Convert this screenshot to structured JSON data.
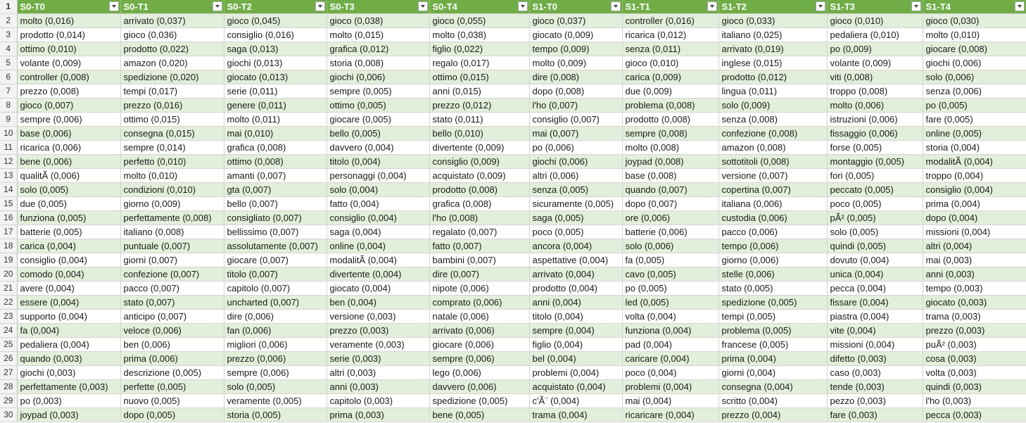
{
  "sheet": {
    "header_row_number": "1",
    "columns": [
      "S0-T0",
      "S0-T1",
      "S0-T2",
      "S0-T3",
      "S0-T4",
      "S1-T0",
      "S1-T1",
      "S1-T2",
      "S1-T3",
      "S1-T4"
    ],
    "rows": [
      {
        "n": "2",
        "cells": [
          "molto (0,016)",
          "arrivato (0,037)",
          "gioco (0,045)",
          "gioco (0,038)",
          "gioco (0,055)",
          "gioco (0,037)",
          "controller (0,016)",
          "gioco (0,033)",
          "gioco (0,010)",
          "gioco (0,030)"
        ]
      },
      {
        "n": "3",
        "cells": [
          "prodotto (0,014)",
          "gioco (0,036)",
          "consiglio (0,016)",
          "molto (0,015)",
          "molto (0,038)",
          "giocato (0,009)",
          "ricarica (0,012)",
          "italiano (0,025)",
          "pedaliera (0,010)",
          "molto (0,010)"
        ]
      },
      {
        "n": "4",
        "cells": [
          "ottimo (0,010)",
          "prodotto (0,022)",
          "saga (0,013)",
          "grafica (0,012)",
          "figlio (0,022)",
          "tempo (0,009)",
          "senza (0,011)",
          "arrivato (0,019)",
          "po (0,009)",
          "giocare (0,008)"
        ]
      },
      {
        "n": "5",
        "cells": [
          "volante (0,009)",
          "amazon (0,020)",
          "giochi (0,013)",
          "storia (0,008)",
          "regalo (0,017)",
          "molto (0,009)",
          "gioco (0,010)",
          "inglese (0,015)",
          "volante (0,009)",
          "giochi (0,006)"
        ]
      },
      {
        "n": "6",
        "cells": [
          "controller (0,008)",
          "spedizione (0,020)",
          "giocato (0,013)",
          "giochi (0,006)",
          "ottimo (0,015)",
          "dire (0,008)",
          "carica (0,009)",
          "prodotto (0,012)",
          "viti (0,008)",
          "solo (0,006)"
        ]
      },
      {
        "n": "7",
        "cells": [
          "prezzo (0,008)",
          "tempi (0,017)",
          "serie (0,011)",
          "sempre (0,005)",
          "anni (0,015)",
          "dopo (0,008)",
          "due (0,009)",
          "lingua (0,011)",
          "troppo (0,008)",
          "senza (0,006)"
        ]
      },
      {
        "n": "8",
        "cells": [
          "gioco (0,007)",
          "prezzo (0,016)",
          "genere (0,011)",
          "ottimo (0,005)",
          "prezzo (0,012)",
          "l'ho (0,007)",
          "problema (0,008)",
          "solo (0,009)",
          "molto (0,006)",
          "po (0,005)"
        ]
      },
      {
        "n": "9",
        "cells": [
          "sempre (0,006)",
          "ottimo (0,015)",
          "molto (0,011)",
          "giocare (0,005)",
          "stato (0,011)",
          "consiglio (0,007)",
          "prodotto (0,008)",
          "senza (0,008)",
          "istruzioni (0,006)",
          "fare (0,005)"
        ]
      },
      {
        "n": "10",
        "cells": [
          "base (0,006)",
          "consegna (0,015)",
          "mai (0,010)",
          "bello (0,005)",
          "bello (0,010)",
          "mai (0,007)",
          "sempre (0,008)",
          "confezione (0,008)",
          "fissaggio (0,006)",
          "online (0,005)"
        ]
      },
      {
        "n": "11",
        "cells": [
          "ricarica (0,006)",
          "sempre (0,014)",
          "grafica (0,008)",
          "davvero (0,004)",
          "divertente (0,009)",
          "po (0,006)",
          "molto (0,008)",
          "amazon (0,008)",
          "forse (0,005)",
          "storia (0,004)"
        ]
      },
      {
        "n": "12",
        "cells": [
          "bene (0,006)",
          "perfetto (0,010)",
          "ottimo (0,008)",
          "titolo (0,004)",
          "consiglio (0,009)",
          "giochi (0,006)",
          "joypad (0,008)",
          "sottotitoli (0,008)",
          "montaggio (0,005)",
          "modalitÃ  (0,004)"
        ]
      },
      {
        "n": "13",
        "cells": [
          "qualitÃ  (0,006)",
          "molto (0,010)",
          "amanti (0,007)",
          "personaggi (0,004)",
          "acquistato (0,009)",
          "altri (0,006)",
          "base (0,008)",
          "versione (0,007)",
          "fori (0,005)",
          "troppo (0,004)"
        ]
      },
      {
        "n": "14",
        "cells": [
          "solo (0,005)",
          "condizioni (0,010)",
          "gta (0,007)",
          "solo (0,004)",
          "prodotto (0,008)",
          "senza (0,005)",
          "quando (0,007)",
          "copertina (0,007)",
          "peccato (0,005)",
          "consiglio (0,004)"
        ]
      },
      {
        "n": "15",
        "cells": [
          "due (0,005)",
          "giorno (0,009)",
          "bello (0,007)",
          "fatto (0,004)",
          "grafica (0,008)",
          "sicuramente (0,005)",
          "dopo (0,007)",
          "italiana (0,006)",
          "poco (0,005)",
          "prima (0,004)"
        ]
      },
      {
        "n": "16",
        "cells": [
          "funziona (0,005)",
          "perfettamente (0,008)",
          "consigliato (0,007)",
          "consiglio (0,004)",
          "l'ho (0,008)",
          "saga (0,005)",
          "ore (0,006)",
          "custodia (0,006)",
          "pÃ² (0,005)",
          "dopo (0,004)"
        ]
      },
      {
        "n": "17",
        "cells": [
          "batterie (0,005)",
          "italiano (0,008)",
          "bellissimo (0,007)",
          "saga (0,004)",
          "regalato (0,007)",
          "poco (0,005)",
          "batterie (0,006)",
          "pacco (0,006)",
          "solo (0,005)",
          "missioni (0,004)"
        ]
      },
      {
        "n": "18",
        "cells": [
          "carica (0,004)",
          "puntuale (0,007)",
          "assolutamente (0,007)",
          "online (0,004)",
          "fatto (0,007)",
          "ancora (0,004)",
          "solo (0,006)",
          "tempo (0,006)",
          "quindi (0,005)",
          "altri (0,004)"
        ]
      },
      {
        "n": "19",
        "cells": [
          "consiglio (0,004)",
          "giorni (0,007)",
          "giocare (0,007)",
          "modalitÃ  (0,004)",
          "bambini (0,007)",
          "aspettative (0,004)",
          "fa (0,005)",
          "giorno (0,006)",
          "dovuto (0,004)",
          "mai (0,003)"
        ]
      },
      {
        "n": "20",
        "cells": [
          "comodo (0,004)",
          "confezione (0,007)",
          "titolo (0,007)",
          "divertente (0,004)",
          "dire (0,007)",
          "arrivato (0,004)",
          "cavo (0,005)",
          "stelle (0,006)",
          "unica (0,004)",
          "anni (0,003)"
        ]
      },
      {
        "n": "21",
        "cells": [
          "avere (0,004)",
          "pacco (0,007)",
          "capitolo (0,007)",
          "giocato (0,004)",
          "nipote (0,006)",
          "prodotto (0,004)",
          "po (0,005)",
          "stato (0,005)",
          "pecca (0,004)",
          "tempo (0,003)"
        ]
      },
      {
        "n": "22",
        "cells": [
          "essere (0,004)",
          "stato (0,007)",
          "uncharted (0,007)",
          "ben (0,004)",
          "comprato (0,006)",
          "anni (0,004)",
          "led (0,005)",
          "spedizione (0,005)",
          "fissare (0,004)",
          "giocato (0,003)"
        ]
      },
      {
        "n": "23",
        "cells": [
          "supporto (0,004)",
          "anticipo (0,007)",
          "dire (0,006)",
          "versione (0,003)",
          "natale (0,006)",
          "titolo (0,004)",
          "volta (0,004)",
          "tempi (0,005)",
          "piastra (0,004)",
          "trama (0,003)"
        ]
      },
      {
        "n": "24",
        "cells": [
          "fa (0,004)",
          "veloce (0,006)",
          "fan (0,006)",
          "prezzo (0,003)",
          "arrivato (0,006)",
          "sempre (0,004)",
          "funziona (0,004)",
          "problema (0,005)",
          "vite (0,004)",
          "prezzo (0,003)"
        ]
      },
      {
        "n": "25",
        "cells": [
          "pedaliera (0,004)",
          "ben (0,006)",
          "migliori (0,006)",
          "veramente (0,003)",
          "giocare (0,006)",
          "figlio (0,004)",
          "pad (0,004)",
          "francese (0,005)",
          "missioni (0,004)",
          "puÃ² (0,003)"
        ]
      },
      {
        "n": "26",
        "cells": [
          "quando (0,003)",
          "prima (0,006)",
          "prezzo (0,006)",
          "serie (0,003)",
          "sempre (0,006)",
          "bel (0,004)",
          "caricare (0,004)",
          "prima (0,004)",
          "difetto (0,003)",
          "cosa (0,003)"
        ]
      },
      {
        "n": "27",
        "cells": [
          "giochi (0,003)",
          "descrizione (0,005)",
          "sempre (0,006)",
          "altri (0,003)",
          "lego (0,006)",
          "problemi (0,004)",
          "poco (0,004)",
          "giorni (0,004)",
          "caso (0,003)",
          "volta (0,003)"
        ]
      },
      {
        "n": "28",
        "cells": [
          "perfettamente (0,003)",
          "perfette (0,005)",
          "solo (0,005)",
          "anni (0,003)",
          "davvero (0,006)",
          "acquistato (0,004)",
          "problemi (0,004)",
          "consegna (0,004)",
          "tende (0,003)",
          "quindi (0,003)"
        ]
      },
      {
        "n": "29",
        "cells": [
          "po (0,003)",
          "nuovo (0,005)",
          "veramente (0,005)",
          "capitolo (0,003)",
          "spedizione (0,005)",
          "c'Ã¨ (0,004)",
          "mai (0,004)",
          "scritto (0,004)",
          "pezzo (0,003)",
          "l'ho (0,003)"
        ]
      },
      {
        "n": "30",
        "cells": [
          "joypad (0,003)",
          "dopo (0,005)",
          "storia (0,005)",
          "prima (0,003)",
          "bene (0,005)",
          "trama (0,004)",
          "ricaricare (0,004)",
          "prezzo (0,004)",
          "fare (0,003)",
          "pecca (0,003)"
        ]
      }
    ]
  },
  "colors": {
    "header_bg": "#70ad47",
    "band_bg": "#e2efda",
    "rownum_bg": "#f3f3f3"
  },
  "icons": {
    "filter": "filter-dropdown-icon"
  }
}
